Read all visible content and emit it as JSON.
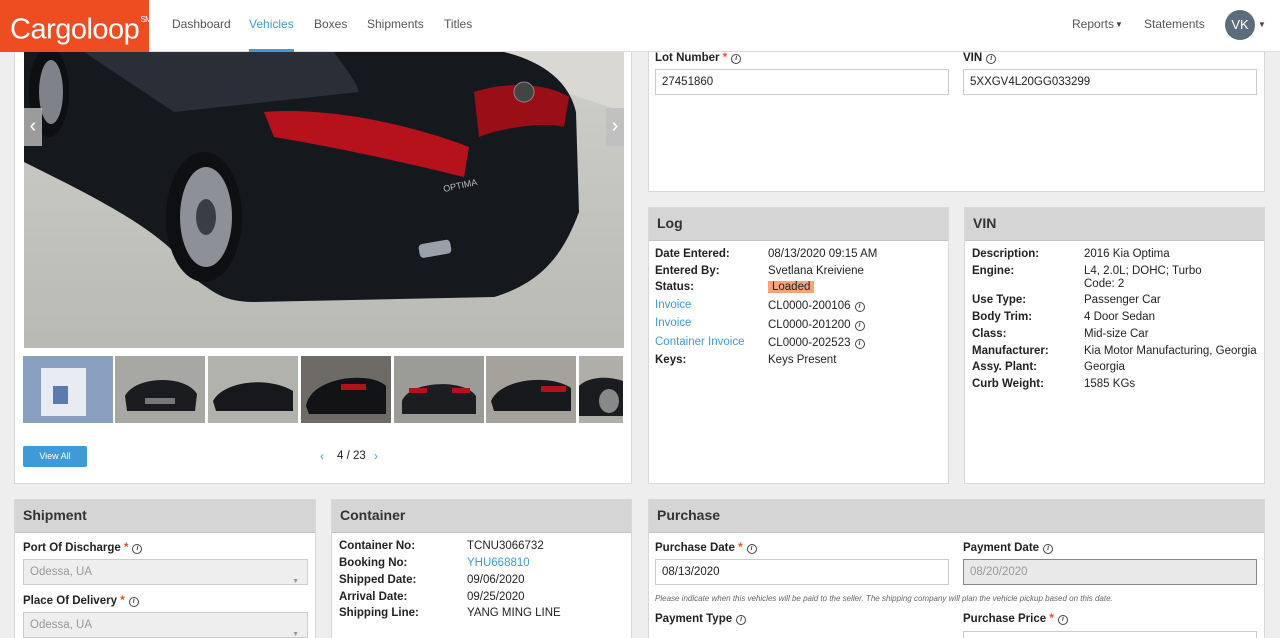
{
  "app": {
    "brand": "Cargoloop",
    "brand_mark": "SM",
    "accent_color": "#ee4d22",
    "link_color": "#3f9ad8"
  },
  "nav": {
    "dashboard": "Dashboard",
    "vehicles": "Vehicles",
    "boxes": "Boxes",
    "shipments": "Shipments",
    "titles": "Titles",
    "reports": "Reports",
    "statements": "Statements",
    "avatar_initials": "VK"
  },
  "gallery": {
    "view_all": "View All",
    "page": "4 / 23"
  },
  "ids": {
    "lot_label": "Lot Number",
    "lot_value": "27451860",
    "vin_label": "VIN",
    "vin_value": "5XXGV4L20GG033299"
  },
  "log": {
    "title": "Log",
    "date_entered_label": "Date Entered:",
    "date_entered": "08/13/2020 09:15 AM",
    "entered_by_label": "Entered By:",
    "entered_by": "Svetlana Kreiviene",
    "status_label": "Status:",
    "status": "Loaded",
    "status_color": "#f4a37a",
    "invoice1_label": "Invoice",
    "invoice1": "CL0000-200106",
    "invoice2_label": "Invoice",
    "invoice2": "CL0000-201200",
    "container_invoice_label": "Container Invoice",
    "container_invoice": "CL0000-202523",
    "keys_label": "Keys:",
    "keys": "Keys Present"
  },
  "vin_panel": {
    "title": "VIN",
    "description_label": "Description:",
    "description": "2016 Kia Optima",
    "engine_label": "Engine:",
    "engine_1": "L4, 2.0L; DOHC; Turbo",
    "engine_2": "Code: 2",
    "use_type_label": "Use Type:",
    "use_type": "Passenger Car",
    "body_trim_label": "Body Trim:",
    "body_trim": "4 Door Sedan",
    "class_label": "Class:",
    "class": "Mid-size Car",
    "manufacturer_label": "Manufacturer:",
    "manufacturer": "Kia Motor Manufacturing, Georgia",
    "assy_plant_label": "Assy. Plant:",
    "assy_plant": "Georgia",
    "curb_weight_label": "Curb Weight:",
    "curb_weight": "1585 KGs"
  },
  "shipment": {
    "title": "Shipment",
    "port_label": "Port Of Discharge",
    "port_value": "Odessa, UA",
    "place_label": "Place Of Delivery",
    "place_value": "Odessa, UA"
  },
  "container": {
    "title": "Container",
    "container_no_label": "Container No:",
    "container_no": "TCNU3066732",
    "booking_no_label": "Booking No:",
    "booking_no": "YHU668810",
    "shipped_date_label": "Shipped Date:",
    "shipped_date": "09/06/2020",
    "arrival_date_label": "Arrival Date:",
    "arrival_date": "09/25/2020",
    "shipping_line_label": "Shipping Line:",
    "shipping_line": "YANG MING LINE"
  },
  "purchase": {
    "title": "Purchase",
    "purchase_date_label": "Purchase Date",
    "purchase_date": "08/13/2020",
    "payment_date_label": "Payment Date",
    "payment_date": "08/20/2020",
    "note": "Please indicate when this vehicles will be paid to the seller. The shipping company will plan the vehicle pickup based on this date.",
    "payment_type_label": "Payment Type",
    "purchase_price_label": "Purchase Price"
  }
}
